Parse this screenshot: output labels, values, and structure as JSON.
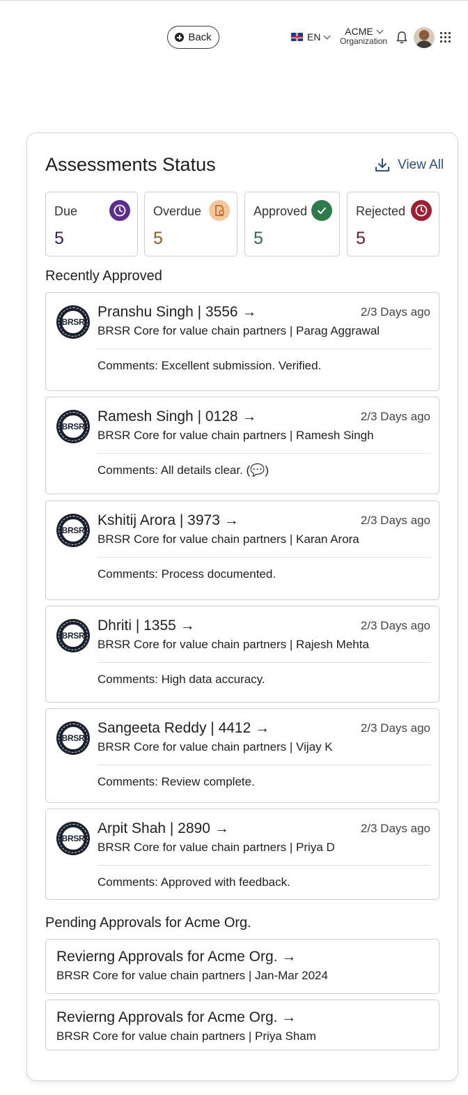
{
  "topbar": {
    "back_label": "Back",
    "language": "EN",
    "org_name": "ACME",
    "org_sub": "Organization"
  },
  "header": {
    "title": "Assessments Status",
    "view_all": "View All"
  },
  "stats": [
    {
      "label": "Due",
      "value": "5",
      "color": "#5b2d8f",
      "icon": "clock-icon"
    },
    {
      "label": "Overdue",
      "value": "5",
      "color": "#e8a26a",
      "icon": "document-icon"
    },
    {
      "label": "Approved",
      "value": "5",
      "color": "#2f7a4a",
      "icon": "check-icon"
    },
    {
      "label": "Rejected",
      "value": "5",
      "color": "#9c1f33",
      "icon": "clock-icon"
    }
  ],
  "recently_approved": {
    "label": "Recently Approved",
    "badge_text": "BRSR",
    "items": [
      {
        "title": "Pranshu Singh | 3556 →",
        "time": "2/3 Days ago",
        "subtitle": "BRSR Core for value chain partners | Parag Aggrawal",
        "comment": "Comments: Excellent submission. Verified."
      },
      {
        "title": "Ramesh Singh | 0128 →",
        "time": "2/3 Days ago",
        "subtitle": "BRSR Core for value chain partners | Ramesh Singh",
        "comment": "Comments: All details clear. (💬)"
      },
      {
        "title": "Kshitij Arora | 3973 →",
        "time": "2/3 Days ago",
        "subtitle": "BRSR Core for value chain partners | Karan Arora",
        "comment": "Comments: Process documented."
      },
      {
        "title": "Dhriti | 1355 →",
        "time": "2/3 Days ago",
        "subtitle": "BRSR Core for value chain partners | Rajesh Mehta",
        "comment": "Comments: High data accuracy."
      },
      {
        "title": "Sangeeta Reddy | 4412 →",
        "time": "2/3 Days ago",
        "subtitle": "BRSR Core for value chain partners | Vijay K",
        "comment": "Comments: Review complete."
      },
      {
        "title": "Arpit Shah | 2890 →",
        "time": "2/3 Days ago",
        "subtitle": "BRSR Core for value chain partners | Priya D",
        "comment": "Comments: Approved with feedback."
      }
    ]
  },
  "pending": {
    "label": "Pending Approvals for Acme Org.",
    "items": [
      {
        "title": "Revierng Approvals for Acme Org. →",
        "subtitle": "BRSR Core for value chain partners | Jan-Mar 2024"
      },
      {
        "title": "Revierng Approvals for Acme Org. →",
        "subtitle": "BRSR Core for value chain partners | Priya Sham"
      }
    ]
  }
}
